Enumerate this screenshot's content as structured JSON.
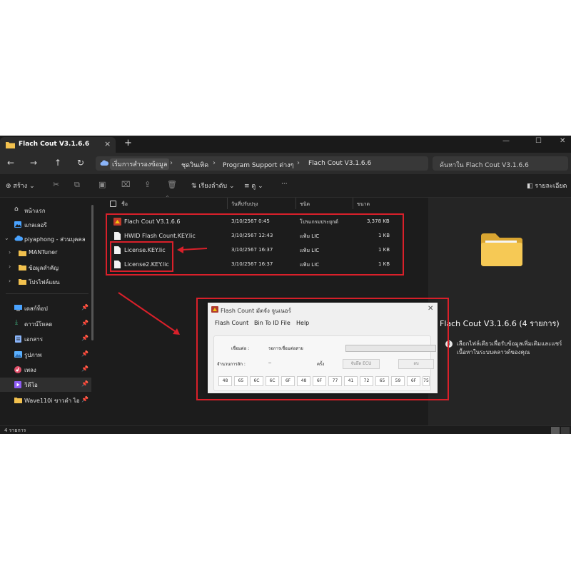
{
  "tab": {
    "title": "Flach Cout V3.1.6.6",
    "close": "×",
    "new": "+"
  },
  "window_controls": {
    "minimize": "—",
    "maximize": "☐",
    "close": "✕"
  },
  "address": {
    "crumbs": [
      "เริ่มการสำรองข้อมูล",
      "ชุดวินเทิค",
      "Program Support ต่างๆ",
      "Flach Cout V3.1.6.6"
    ],
    "search_placeholder": "ค้นหาใน Flach Cout V3.1.6.6"
  },
  "toolbar": {
    "new_label": "สร้าง",
    "sort_label": "เรียงลำดับ",
    "view_label": "ดู",
    "more_label": "···",
    "details_label": "รายละเอียด"
  },
  "sidebar": {
    "items": [
      {
        "label": "หน้าแรก"
      },
      {
        "label": "แกลเลอรี"
      },
      {
        "label": "piyaphong - ส่วนบุคคล"
      },
      {
        "label": "MANTuner"
      },
      {
        "label": "ข้อมูลสำคัญ"
      },
      {
        "label": "โปรไฟล์แผน"
      },
      {
        "label": "เดสก์ท็อป"
      },
      {
        "label": "ดาวน์โหลด"
      },
      {
        "label": "เอกสาร"
      },
      {
        "label": "รูปภาพ"
      },
      {
        "label": "เพลง"
      },
      {
        "label": "วิดีโอ"
      },
      {
        "label": "Wave110i ขาวดำ ไอ"
      }
    ]
  },
  "columns": {
    "name": "ชื่อ",
    "date": "วันที่ปรับปรุง",
    "type": "ชนิด",
    "size": "ขนาด"
  },
  "files": [
    {
      "name": "Flach Cout V3.1.6.6",
      "date": "3/10/2567 0:45",
      "type": "โปรแกรมประยุกต์",
      "size": "3,378 KB"
    },
    {
      "name": "HWID Flash Count.KEY.lic",
      "date": "3/10/2567 12:43",
      "type": "แฟ้ม LIC",
      "size": "1 KB"
    },
    {
      "name": "License.KEY.lic",
      "date": "3/10/2567 16:37",
      "type": "แฟ้ม LIC",
      "size": "1 KB"
    },
    {
      "name": "License2.KEY.lic",
      "date": "3/10/2567 16:37",
      "type": "แฟ้ม LIC",
      "size": "1 KB"
    }
  ],
  "details": {
    "title": "Flach Cout V3.1.6.6 (4 รายการ)",
    "info_icon": "i",
    "info": "เลือกไฟล์เดียวเพื่อรับข้อมูลเพิ่มเติมและแชร์เนื้อหาในระบบคลาวด์ของคุณ"
  },
  "status": {
    "count": "4 รายการ"
  },
  "dialog": {
    "title": "Flash Count  มัตจัง จูนเนอร์",
    "close": "✕",
    "menu": [
      "Flash Count",
      "Bin To ID File",
      "Help"
    ],
    "connect_label": "เชื่อมต่อ :",
    "connect_value": "รอการเชื่อมต่อสาย",
    "count_label": "จำนวนการลัก :",
    "count_value": "--",
    "times_label": "ครั้ง",
    "read_ecu_button": "จับยึด ECU",
    "clear_button": "ลบ",
    "progress": 0,
    "hex": [
      "48",
      "65",
      "6C",
      "6C",
      "6F",
      "48",
      "6F",
      "77",
      "41",
      "72",
      "65",
      "59",
      "6F",
      "75"
    ]
  },
  "colors": {
    "annotation": "#d9202a",
    "folder": "#f2c14e"
  }
}
